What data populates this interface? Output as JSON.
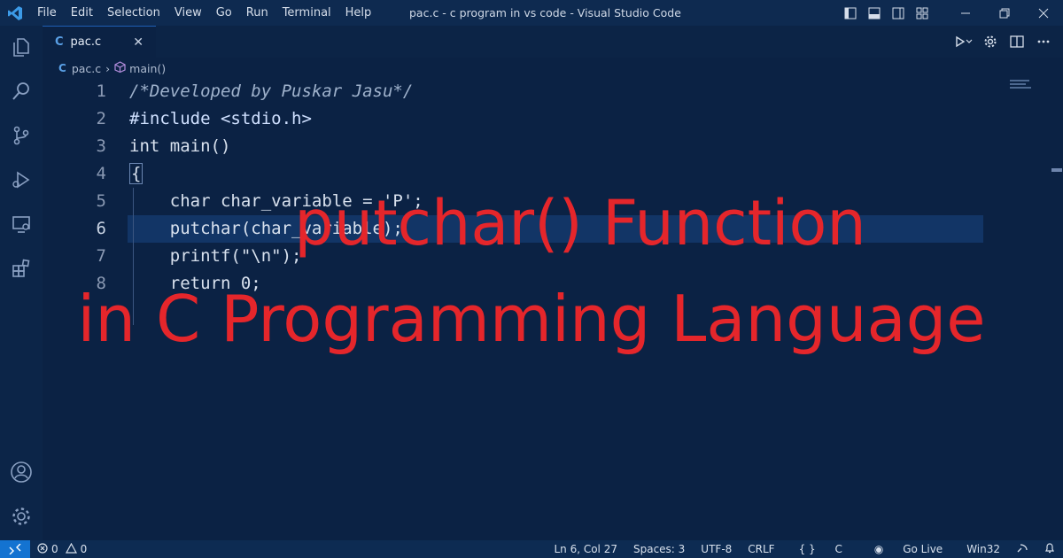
{
  "window": {
    "title": "pac.c - c program in vs code - Visual Studio Code",
    "menu": [
      "File",
      "Edit",
      "Selection",
      "View",
      "Go",
      "Run",
      "Terminal",
      "Help"
    ]
  },
  "tabs": [
    {
      "label": "pac.c",
      "language_icon": "C",
      "active": true
    }
  ],
  "breadcrumb": {
    "file": "pac.c",
    "symbol": "main()"
  },
  "editor": {
    "lines": [
      {
        "number": "1",
        "text": "/*Developed by Puskar Jasu*/"
      },
      {
        "number": "2",
        "text": "#include <stdio.h>"
      },
      {
        "number": "3",
        "text": "int main()"
      },
      {
        "number": "4",
        "text": "{"
      },
      {
        "number": "5",
        "text": "    char char_variable = 'P';"
      },
      {
        "number": "6",
        "text": "    putchar(char_variable);"
      },
      {
        "number": "7",
        "text": "    printf(\"\\n\");"
      },
      {
        "number": "8",
        "text": "    return 0;"
      }
    ],
    "current_line": "6"
  },
  "overlay": {
    "line1": "putchar() Function",
    "line2": "in C Programming Language",
    "color": "#e5262b"
  },
  "statusbar": {
    "errors": "0",
    "warnings": "0",
    "position": "Ln 6, Col 27",
    "spaces": "Spaces: 3",
    "encoding": "UTF-8",
    "eol": "CRLF",
    "language": "C",
    "golive": "Go Live",
    "platform": "Win32"
  },
  "colors": {
    "background": "#0b2244",
    "accent": "#1473d1"
  }
}
